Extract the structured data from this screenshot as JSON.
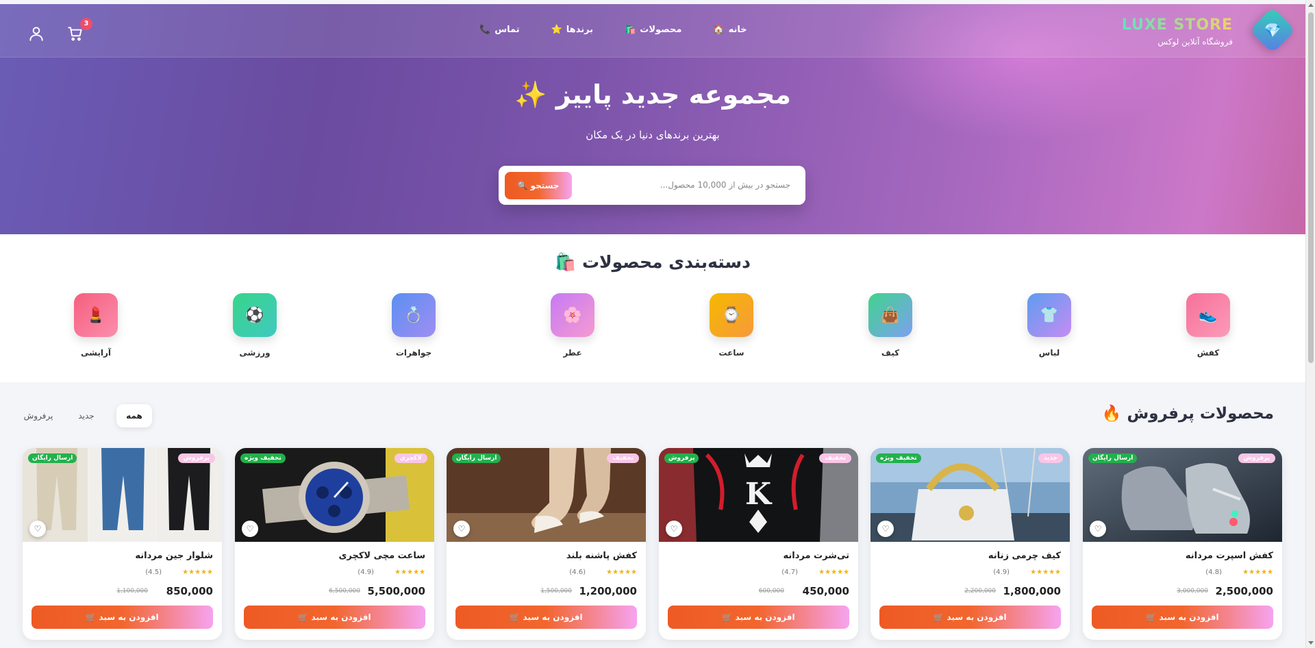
{
  "brand": {
    "name": "LUXE STORE",
    "subtitle": "فروشگاه آنلاین لوکس",
    "logo_icon": "💎"
  },
  "nav": {
    "links": [
      {
        "label": "خانه",
        "icon": "🏠"
      },
      {
        "label": "محصولات",
        "icon": "🛍️"
      },
      {
        "label": "برندها",
        "icon": "⭐"
      },
      {
        "label": "تماس",
        "icon": "📞"
      }
    ],
    "cart_count": "3"
  },
  "hero": {
    "title": "مجموعه جدید پاییز",
    "title_icon": "✨",
    "subtitle": "بهترین برندهای دنیا در یک مکان",
    "search_placeholder": "جستجو در بیش از 10,000 محصول...",
    "search_button": "جستجو",
    "search_icon": "🔍"
  },
  "categories": {
    "title": "دسته‌بندی محصولات",
    "title_icon": "🛍️",
    "items": [
      {
        "label": "کفش",
        "icon": "👟",
        "colors": [
          "#f7709a",
          "#fb9bb8"
        ]
      },
      {
        "label": "لباس",
        "icon": "👕",
        "colors": [
          "#5e9cf0",
          "#c58cf2"
        ]
      },
      {
        "label": "کیف",
        "icon": "👜",
        "colors": [
          "#3fd38d",
          "#7da0f0"
        ]
      },
      {
        "label": "ساعت",
        "icon": "⌚",
        "colors": [
          "#f5b800",
          "#f79a3a"
        ]
      },
      {
        "label": "عطر",
        "icon": "🌸",
        "colors": [
          "#c57af5",
          "#f79ad0"
        ]
      },
      {
        "label": "جواهرات",
        "icon": "💍",
        "colors": [
          "#5b8ff2",
          "#a08ef2"
        ]
      },
      {
        "label": "ورزشی",
        "icon": "⚽",
        "colors": [
          "#37d58a",
          "#40c9c0"
        ]
      },
      {
        "label": "آرایشی",
        "icon": "💄",
        "colors": [
          "#f65e7f",
          "#fb8eac"
        ]
      }
    ]
  },
  "bestsellers": {
    "title": "محصولات پرفروش",
    "title_icon": "🔥",
    "tabs": [
      "همه",
      "جدید",
      "پرفروش"
    ]
  },
  "products": [
    {
      "name": "کفش اسپرت مردانه",
      "rating": "(4.8)",
      "price": "2,500,000",
      "old_price": "3,000,000",
      "badge_left": "ارسال رایگان",
      "badge_right": "پرفروش",
      "stars": "★★★★★"
    },
    {
      "name": "کیف چرمی زنانه",
      "rating": "(4.9)",
      "price": "1,800,000",
      "old_price": "2,200,000",
      "badge_left": "تخفیف ویژه",
      "badge_right": "جدید",
      "stars": "★★★★★"
    },
    {
      "name": "تی‌شرت مردانه",
      "rating": "(4.7)",
      "price": "450,000",
      "old_price": "600,000",
      "badge_left": "پرفروش",
      "badge_right": "تخفیف",
      "stars": "★★★★★"
    },
    {
      "name": "کفش پاشنه بلند",
      "rating": "(4.6)",
      "price": "1,200,000",
      "old_price": "1,500,000",
      "badge_left": "ارسال رایگان",
      "badge_right": "تخفیف",
      "stars": "★★★★★"
    },
    {
      "name": "ساعت مچی لاکچری",
      "rating": "(4.9)",
      "price": "5,500,000",
      "old_price": "6,500,000",
      "badge_left": "تخفیف ویژه",
      "badge_right": "لاکچری",
      "stars": "★★★★★"
    },
    {
      "name": "شلوار جین مردانه",
      "rating": "(4.5)",
      "price": "850,000",
      "old_price": "1,100,000",
      "badge_left": "ارسال رایگان",
      "badge_right": "پرفروش",
      "stars": "★★★★★"
    }
  ],
  "add_to_cart": "افزودن به سبد",
  "add_to_cart_icon": "🛒"
}
